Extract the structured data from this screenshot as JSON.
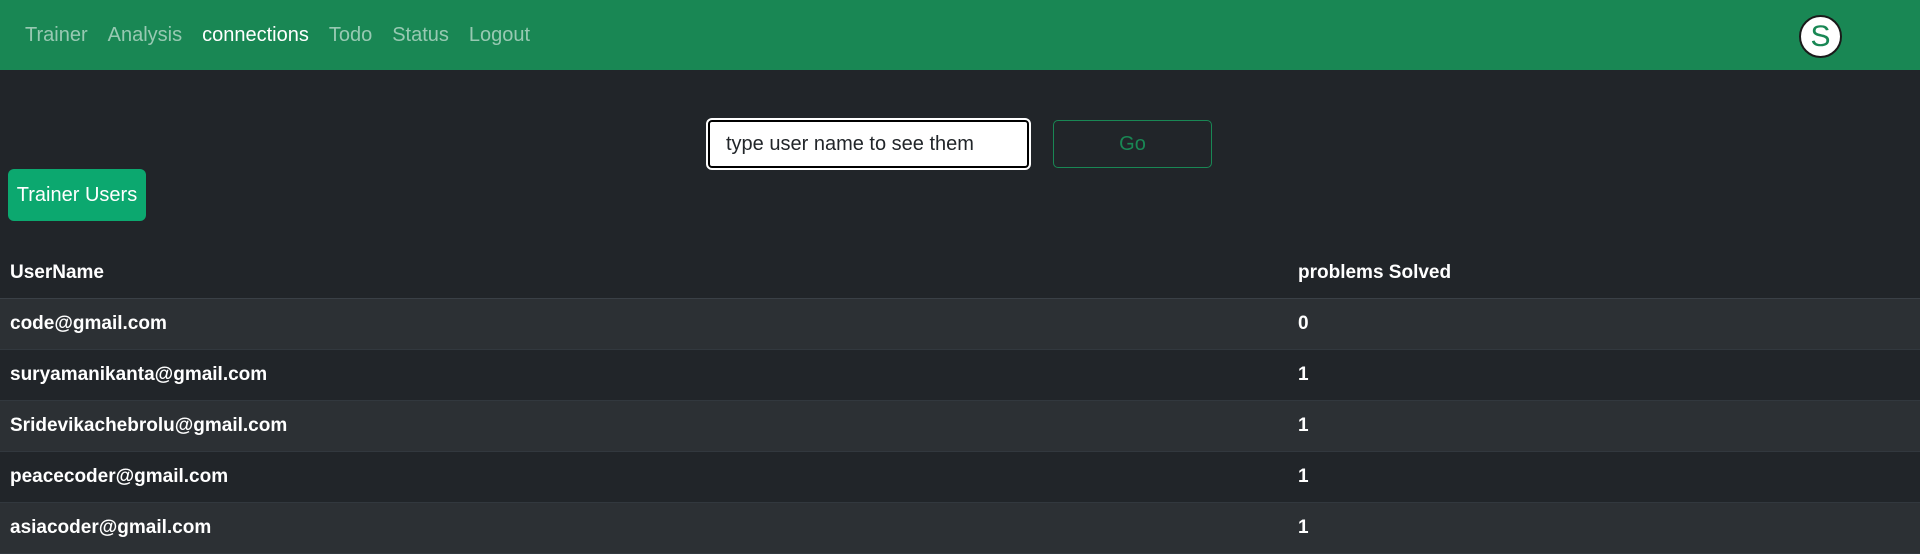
{
  "nav": {
    "links": [
      {
        "label": "Trainer"
      },
      {
        "label": "Analysis"
      },
      {
        "label": "connections",
        "active": true
      },
      {
        "label": "Todo"
      },
      {
        "label": "Status"
      },
      {
        "label": "Logout"
      }
    ],
    "avatar_letter": "S"
  },
  "search": {
    "placeholder": "type user name to see them",
    "value": "",
    "go_label": "Go"
  },
  "trainer_users_label": "Trainer Users",
  "table": {
    "headers": {
      "username": "UserName",
      "solved": "problems Solved"
    },
    "rows": [
      {
        "username": "code@gmail.com",
        "solved": "0"
      },
      {
        "username": "suryamanikanta@gmail.com",
        "solved": "1"
      },
      {
        "username": "Sridevikachebrolu@gmail.com",
        "solved": "1"
      },
      {
        "username": "peacecoder@gmail.com",
        "solved": "1"
      },
      {
        "username": "asiacoder@gmail.com",
        "solved": "1"
      }
    ]
  },
  "colors": {
    "navbar": "#198754",
    "background": "#212529",
    "accent_button": "#0ca86f"
  }
}
